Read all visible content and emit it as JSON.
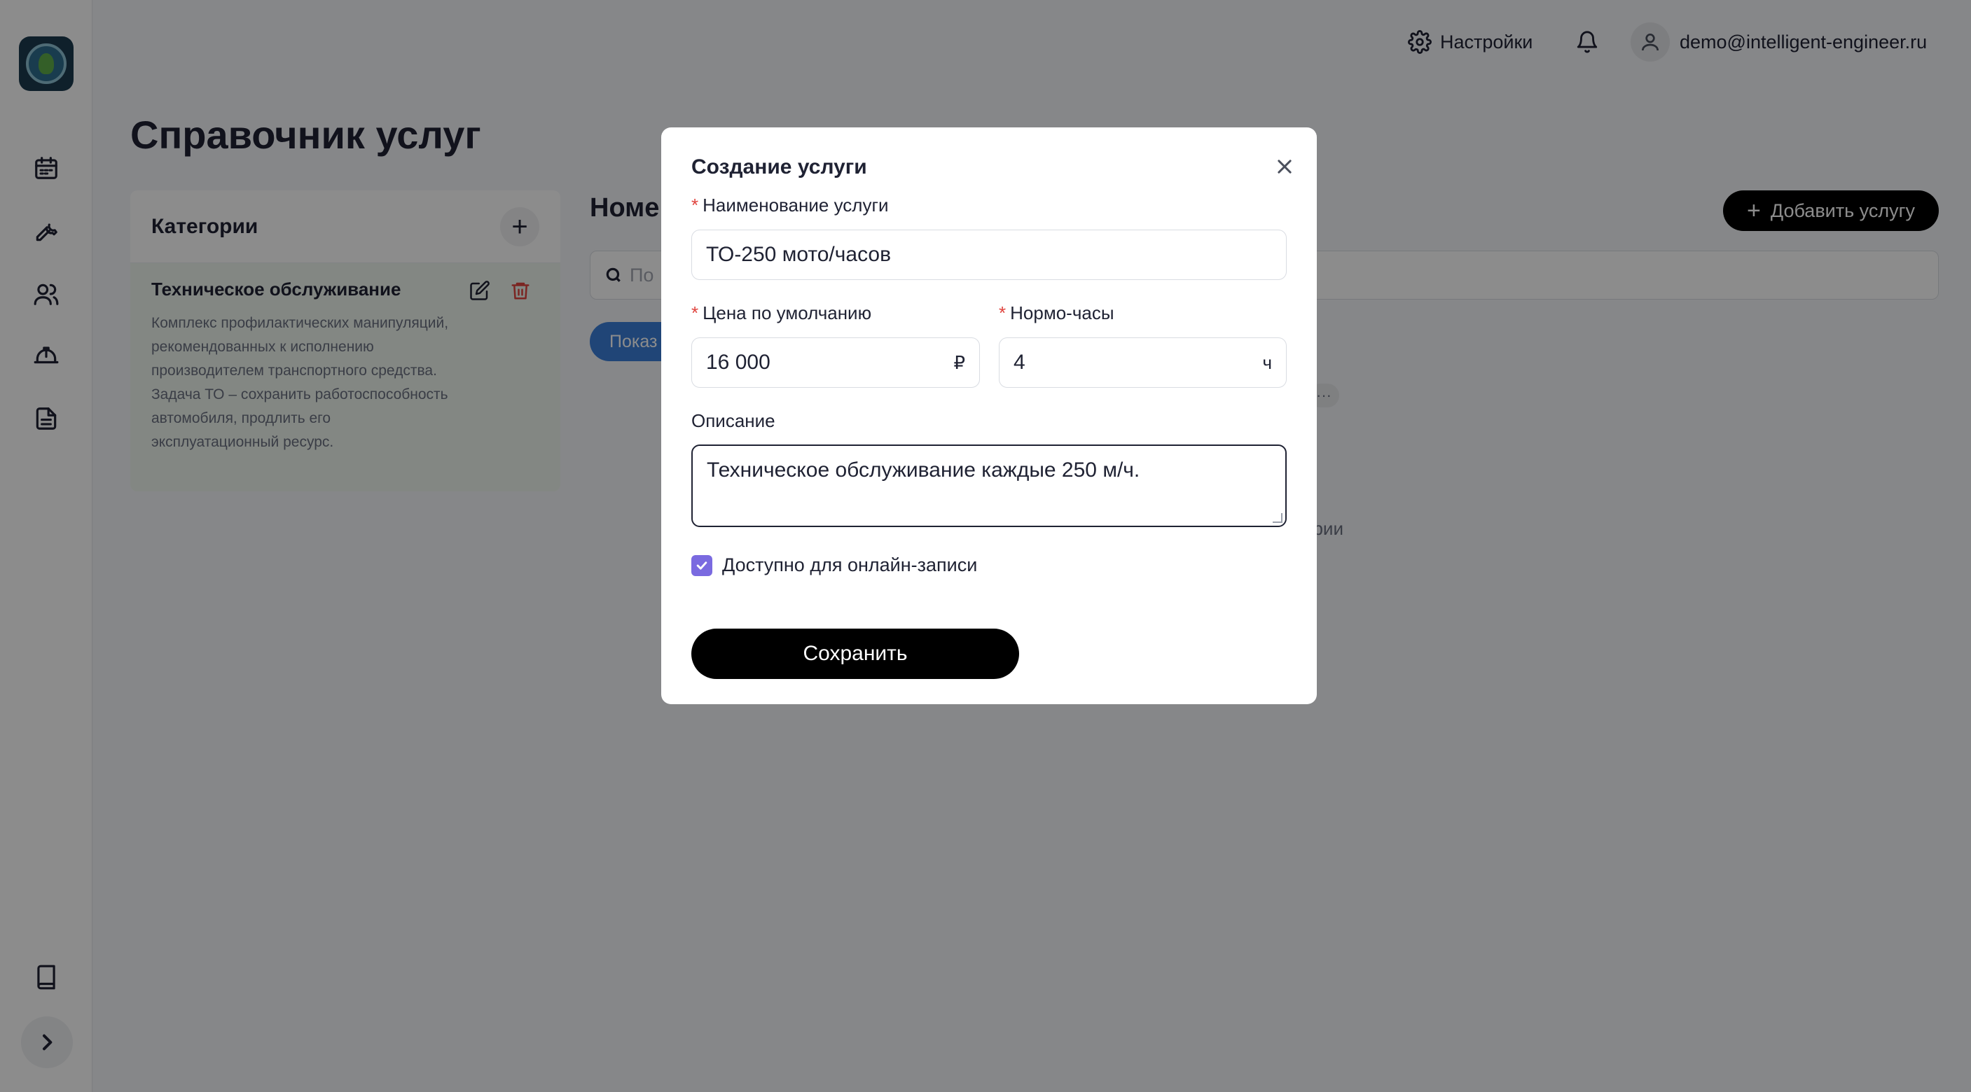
{
  "header": {
    "settings_label": "Настройки",
    "user_email": "demo@intelligent-engineer.ru"
  },
  "page": {
    "title": "Справочник услуг"
  },
  "categories": {
    "title": "Категории",
    "items": [
      {
        "name": "Техническое обслуживание",
        "description": "Комплекс профилактических манипуляций, рекомендованных к исполнению производителем транспортного средства. Задача ТО – сохранить работоспособность автомобиля, продлить его эксплуатационный ресурс."
      }
    ]
  },
  "services": {
    "title": "Номе",
    "add_button_label": "Добавить услугу",
    "search_placeholder": "По",
    "show_button_label": "Показ",
    "empty_note": "ории"
  },
  "modal": {
    "title": "Создание услуги",
    "name_label": "Наименование услуги",
    "name_value": "ТО-250 мото/часов",
    "price_label": "Цена по умолчанию",
    "price_value": "16 000",
    "price_unit": "₽",
    "hours_label": "Нормо-часы",
    "hours_value": "4",
    "hours_unit": "ч",
    "description_label": "Описание",
    "description_value": "Техническое обслуживание каждые 250 м/ч.",
    "online_label": "Доступно для онлайн-записи",
    "online_checked": true,
    "save_label": "Сохранить",
    "required_mark": "*"
  },
  "colors": {
    "primary": "#000000",
    "checkbox": "#7a6ae0",
    "danger": "#e0443e",
    "category_selected_bg": "#eef6ef"
  }
}
